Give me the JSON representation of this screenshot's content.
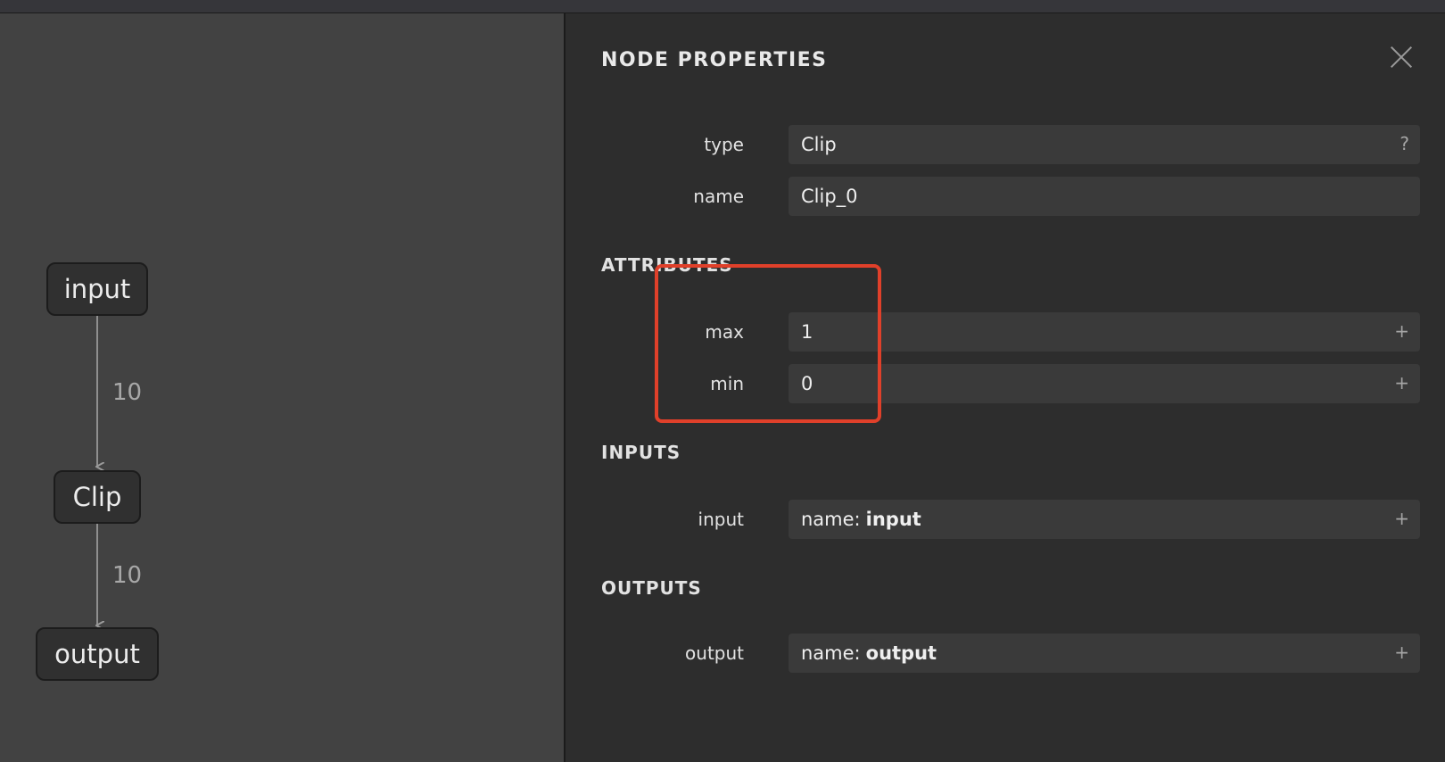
{
  "graph": {
    "nodes": [
      {
        "id": "node-input",
        "label": "input"
      },
      {
        "id": "node-clip",
        "label": "Clip"
      },
      {
        "id": "node-output",
        "label": "output"
      }
    ],
    "edges": [
      {
        "label": "10"
      },
      {
        "label": "10"
      }
    ]
  },
  "panel": {
    "title": "NODE PROPERTIES",
    "type_label": "type",
    "type_value": "Clip",
    "type_action": "?",
    "name_label": "name",
    "name_value": "Clip_0",
    "attributes_title": "ATTRIBUTES",
    "attributes": [
      {
        "label": "max",
        "value": "1",
        "action": "+"
      },
      {
        "label": "min",
        "value": "0",
        "action": "+"
      }
    ],
    "inputs_title": "INPUTS",
    "inputs": [
      {
        "label": "input",
        "prefix": "name:",
        "value": "input",
        "action": "+"
      }
    ],
    "outputs_title": "OUTPUTS",
    "outputs": [
      {
        "label": "output",
        "prefix": "name:",
        "value": "output",
        "action": "+"
      }
    ]
  },
  "colors": {
    "highlight": "#e0402a",
    "panel_bg": "#2d2d2d",
    "graph_bg": "#424242"
  }
}
